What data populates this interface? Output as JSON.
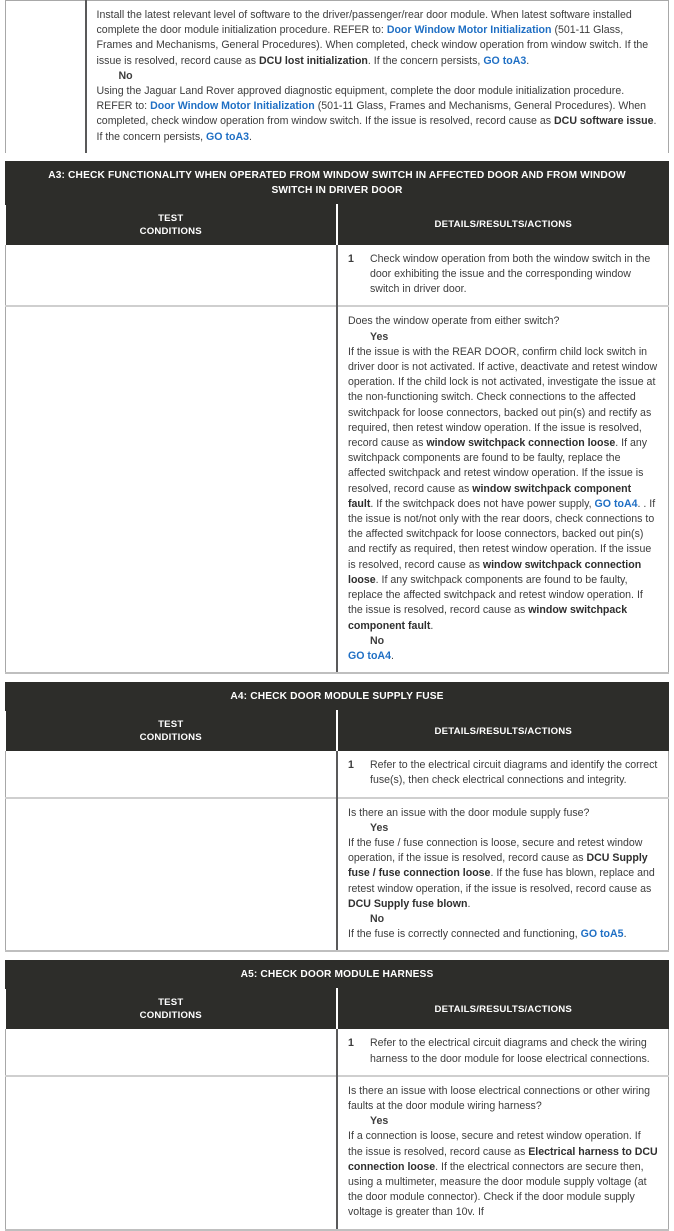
{
  "colors": {
    "header_bg": "#2d2d2a",
    "header_text": "#ffffff",
    "link": "#1f6fc4",
    "body_text": "#3d3d3d",
    "border": "#a8a8a8",
    "row_separator": "#cfcfcf",
    "page_bg": "#ffffff"
  },
  "columns": {
    "test_conditions": "TEST\nCONDITIONS",
    "test_conditions_line1": "TEST",
    "test_conditions_line2": "CONDITIONS",
    "details": "DETAILS/RESULTS/ACTIONS"
  },
  "continued_block": {
    "paragraphs": [
      {
        "id": "yes-branch-continued",
        "runs": [
          {
            "type": "text",
            "text": "Install the latest relevant level of software to the driver/passenger/rear door module. When latest software installed complete the door module initialization procedure. REFER to: "
          },
          {
            "type": "link",
            "text": "Door Window Motor Initialization"
          },
          {
            "type": "text",
            "text": " (501-11 Glass, Frames and Mechanisms, General Procedures). When completed, check window operation from window switch. If the issue is resolved, record cause as "
          },
          {
            "type": "bold",
            "text": "DCU lost initialization"
          },
          {
            "type": "text",
            "text": ". If the concern persists, "
          },
          {
            "type": "link",
            "text": "GO toA3"
          },
          {
            "type": "text",
            "text": "."
          }
        ]
      }
    ],
    "answer_no": "No",
    "no_paragraph": {
      "runs": [
        {
          "type": "text",
          "text": "Using the Jaguar Land Rover approved diagnostic equipment, complete the door module initialization procedure. REFER to: "
        },
        {
          "type": "link",
          "text": "Door Window Motor Initialization"
        },
        {
          "type": "text",
          "text": " (501-11 Glass, Frames and Mechanisms, General Procedures). When completed, check window operation from window switch. If the issue is resolved, record cause as "
        },
        {
          "type": "bold",
          "text": "DCU software issue"
        },
        {
          "type": "text",
          "text": ". If the concern persists, "
        },
        {
          "type": "link",
          "text": "GO toA3"
        },
        {
          "type": "text",
          "text": "."
        }
      ]
    }
  },
  "sections": [
    {
      "id": "A3",
      "title": "A3: CHECK FUNCTIONALITY WHEN OPERATED FROM WINDOW SWITCH IN AFFECTED DOOR AND FROM WINDOW SWITCH IN DRIVER DOOR",
      "step_number": "1",
      "step_text": "Check window operation from both the window switch in the door exhibiting the issue and the corresponding window switch in driver door.",
      "question": "Does the window operate from either switch?",
      "answer_yes": "Yes",
      "answer_no": "No",
      "yes_runs": [
        {
          "type": "text",
          "text": "If the issue is with the REAR DOOR, confirm child lock switch in driver door is not activated. If active, deactivate and retest window operation. If the child lock is not activated, investigate the issue at the non-functioning switch. Check connections to the affected switchpack for loose connectors, backed out pin(s) and rectify as required, then retest window operation. If the issue is resolved, record cause as "
        },
        {
          "type": "bold",
          "text": "window switchpack connection loose"
        },
        {
          "type": "text",
          "text": ". If any switchpack components are found to be faulty, replace the affected switchpack and retest window operation. If the issue is resolved, record cause as "
        },
        {
          "type": "bold",
          "text": "window switchpack component fault"
        },
        {
          "type": "text",
          "text": ". If the switchpack does not have power supply, "
        },
        {
          "type": "link",
          "text": "GO toA4"
        },
        {
          "type": "text",
          "text": ". . If the issue is not/not only with the rear doors, check connections to the affected switchpack for loose connectors, backed out pin(s) and rectify as required, then retest window operation. If the issue is resolved, record cause as "
        },
        {
          "type": "bold",
          "text": "window switchpack connection loose"
        },
        {
          "type": "text",
          "text": ". If any switchpack components are found to be faulty, replace the affected switchpack and retest window operation. If the issue is resolved, record cause as "
        },
        {
          "type": "bold",
          "text": "window switchpack component fault"
        },
        {
          "type": "text",
          "text": "."
        }
      ],
      "no_runs": [
        {
          "type": "link",
          "text": "GO toA4"
        },
        {
          "type": "text",
          "text": "."
        }
      ]
    },
    {
      "id": "A4",
      "title": "A4: CHECK DOOR MODULE SUPPLY FUSE",
      "step_number": "1",
      "step_text": "Refer to the electrical circuit diagrams and identify the correct fuse(s), then check electrical connections and integrity.",
      "question": "Is there an issue with the door module supply fuse?",
      "answer_yes": "Yes",
      "answer_no": "No",
      "yes_runs": [
        {
          "type": "text",
          "text": "If the fuse / fuse connection is loose, secure and retest window operation, if the issue is resolved, record cause as "
        },
        {
          "type": "bold",
          "text": "DCU Supply fuse / fuse connection loose"
        },
        {
          "type": "text",
          "text": ". If the fuse has blown, replace and retest window operation, if the issue is resolved, record cause as "
        },
        {
          "type": "bold",
          "text": "DCU Supply fuse blown"
        },
        {
          "type": "text",
          "text": "."
        }
      ],
      "no_runs": [
        {
          "type": "text",
          "text": "If the fuse is correctly connected and functioning, "
        },
        {
          "type": "link",
          "text": "GO toA5"
        },
        {
          "type": "text",
          "text": "."
        }
      ]
    },
    {
      "id": "A5",
      "title": "A5: CHECK DOOR MODULE HARNESS",
      "step_number": "1",
      "step_text": "Refer to the electrical circuit diagrams and check the wiring harness to the door module for loose electrical connections.",
      "question": "Is there an issue with loose electrical connections or other wiring faults at the door module wiring harness?",
      "answer_yes": "Yes",
      "answer_no": null,
      "yes_runs": [
        {
          "type": "text",
          "text": "If a connection is loose, secure and retest window operation. If the issue is resolved, record cause as "
        },
        {
          "type": "bold",
          "text": "Electrical harness to DCU connection loose"
        },
        {
          "type": "text",
          "text": ". If the electrical connectors are secure then, using a multimeter, measure the door module supply voltage (at the door module connector). Check if the door module supply voltage is greater than 10v. If"
        }
      ],
      "no_runs": []
    }
  ]
}
